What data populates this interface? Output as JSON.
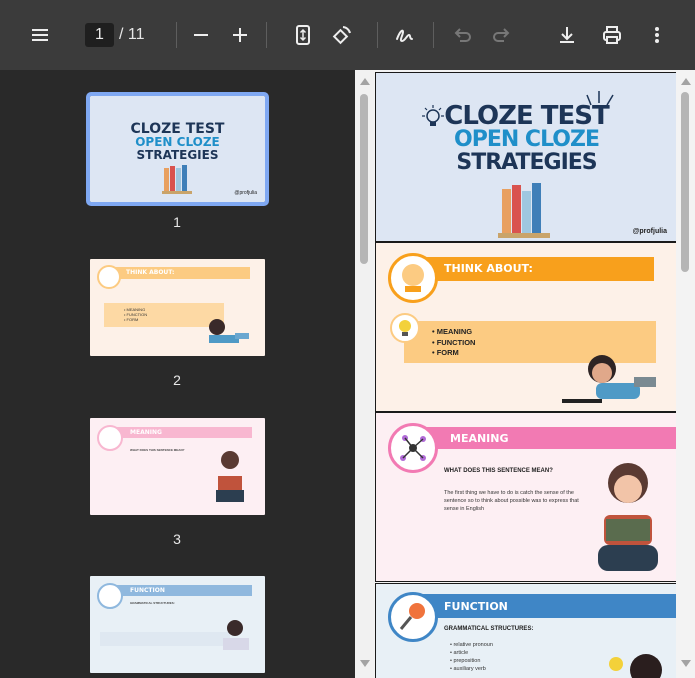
{
  "toolbar": {
    "current_page": "1",
    "total_pages": "/ 11",
    "icons": [
      "menu-icon",
      "zoom-out-icon",
      "zoom-in-icon",
      "fit-page-icon",
      "rotate-icon",
      "annotate-icon",
      "undo-icon",
      "redo-icon",
      "download-icon",
      "print-icon",
      "more-icon"
    ]
  },
  "thumbnails": {
    "items": [
      {
        "number": "1"
      },
      {
        "number": "2"
      },
      {
        "number": "3"
      },
      {
        "number": "4"
      }
    ]
  },
  "slides": {
    "s1": {
      "line1": "CLOZE TEST",
      "line2": "OPEN CLOZE",
      "line3": "STRATEGIES",
      "handle": "@profjulia",
      "colors": {
        "navy": "#1d3557",
        "blue": "#1f8fc9",
        "bg": "#dde6f3"
      }
    },
    "s2": {
      "title": "THINK ABOUT:",
      "bullets": [
        "MEANING",
        "FUNCTION",
        "FORM"
      ],
      "colors": {
        "orange": "#f8a01c",
        "peach": "#fccb82",
        "bg": "#fdf1e8"
      }
    },
    "s3": {
      "title": "MEANING",
      "question": "WHAT DOES THIS SENTENCE MEAN?",
      "body": "The first thing we have to do is catch the sense of the sentence so to think about possible was to express that sense in English",
      "colors": {
        "pink": "#f27ab3",
        "bg": "#fdeff3"
      }
    },
    "s4": {
      "title": "FUNCTION",
      "subtitle": "GRAMMATICAL STRUCTURES:",
      "bullets": [
        "relative pronoun",
        "article",
        "preposition",
        "auxiliary verb"
      ],
      "colors": {
        "blue": "#3f86c6",
        "bg": "#e8f0f6"
      }
    }
  }
}
